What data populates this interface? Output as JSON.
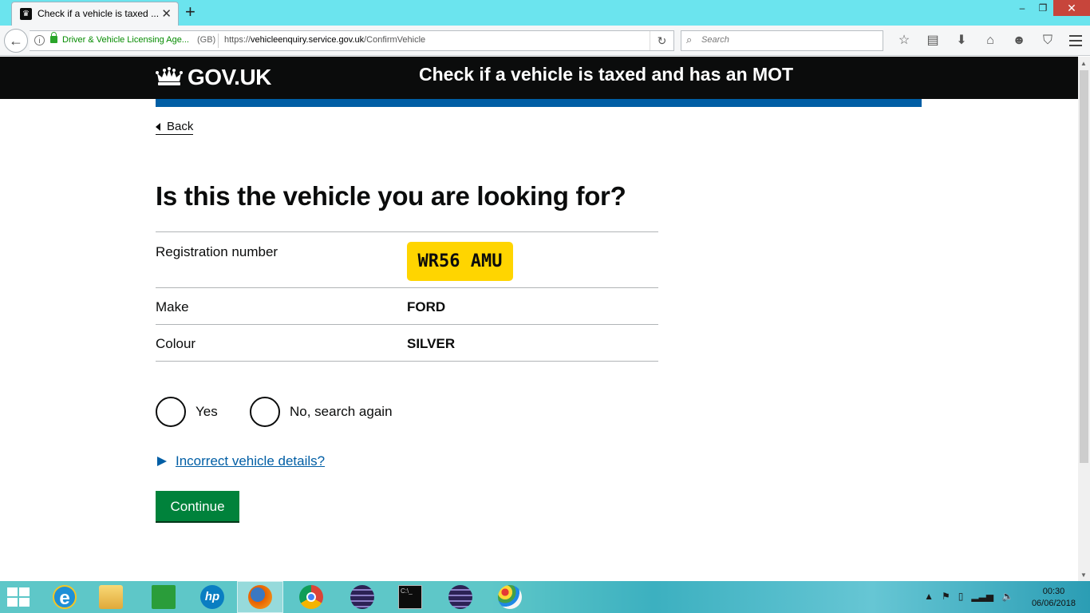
{
  "browser": {
    "tab_title": "Check if a vehicle is taxed ...",
    "new_tab_symbol": "+",
    "identity_label": "Driver & Vehicle Licensing Age...",
    "country_label": "(GB)",
    "url_prefix": "https://",
    "url_host": "vehicleenquiry.service.gov.uk",
    "url_path": "/ConfirmVehicle",
    "search_placeholder": "Search",
    "toolbar_icons": [
      "star-icon",
      "reading-list-icon",
      "download-icon",
      "home-icon",
      "chat-icon",
      "pocket-icon",
      "menu-icon"
    ]
  },
  "header": {
    "brand": "GOV.UK",
    "service_name": "Check if a vehicle is taxed and has an MOT"
  },
  "page": {
    "back_label": "Back",
    "heading": "Is this the vehicle you are looking for?",
    "summary": {
      "registration_label": "Registration number",
      "registration_value": "WR56 AMU",
      "make_label": "Make",
      "make_value": "FORD",
      "colour_label": "Colour",
      "colour_value": "SILVER"
    },
    "radios": [
      {
        "label": "Yes",
        "checked": false
      },
      {
        "label": "No, search again",
        "checked": false
      }
    ],
    "details_link": "Incorrect vehicle details?",
    "continue_label": "Continue"
  },
  "colors": {
    "header_bg": "#0b0c0c",
    "brand_blue": "#005ea5",
    "plate_yellow": "#ffd500",
    "button_green": "#00823b"
  },
  "taskbar": {
    "apps": [
      "internet-explorer",
      "file-explorer",
      "store",
      "hp",
      "firefox",
      "chrome",
      "eclipse",
      "command-prompt",
      "eclipse",
      "paint"
    ],
    "active_app": "firefox",
    "time": "00:30",
    "date": "06/06/2018"
  }
}
